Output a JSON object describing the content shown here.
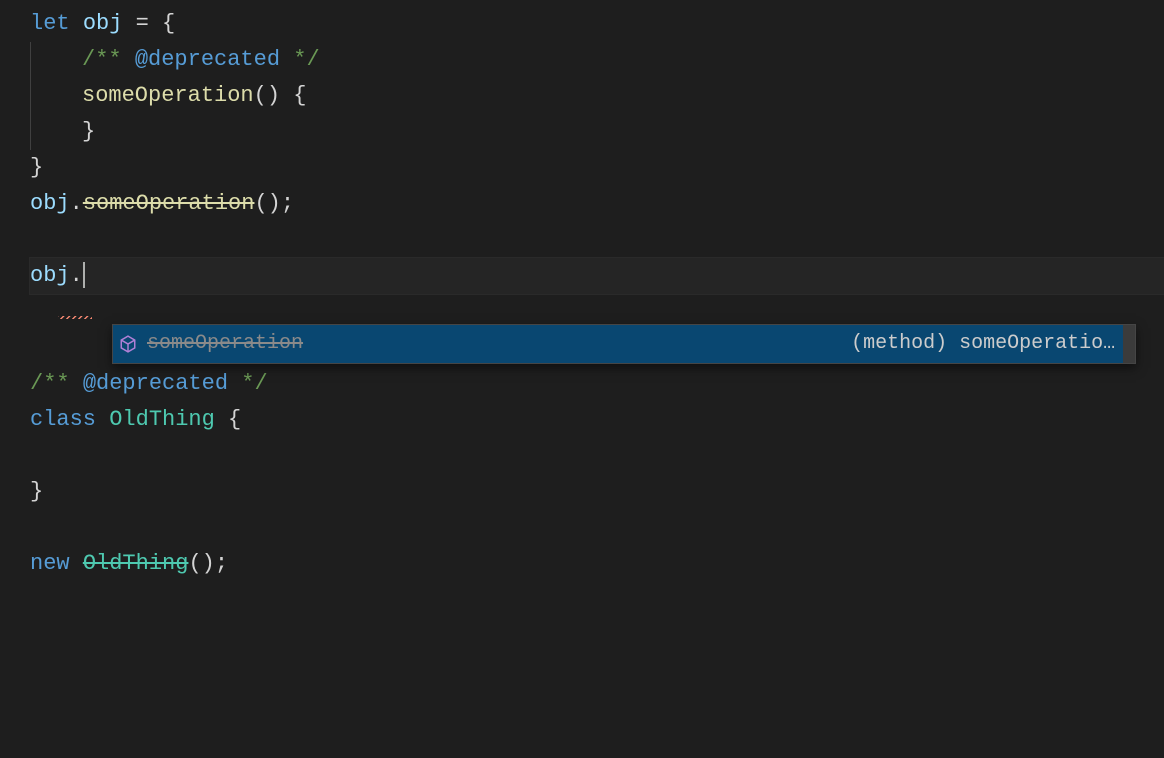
{
  "code": {
    "line1": {
      "let": "let",
      "sp1": " ",
      "obj": "obj",
      "sp2": " ",
      "eq": "=",
      "sp3": " ",
      "brace": "{"
    },
    "line2": {
      "comment_open": "/** ",
      "tag": "@deprecated",
      "comment_close": " */"
    },
    "line3": {
      "fn": "someOperation",
      "call": "() {"
    },
    "line4": {
      "brace": "}"
    },
    "line5": {
      "brace": "}"
    },
    "line6": {
      "obj": "obj",
      "dot": ".",
      "fn": "someOperation",
      "call": "();"
    },
    "line8": {
      "obj": "obj",
      "dot": "."
    },
    "line11": {
      "open": "/** ",
      "tag": "@deprecated",
      "close": " */"
    },
    "line12": {
      "class": "class",
      "sp": " ",
      "name": "OldThing",
      "rest": " {"
    },
    "line14": {
      "brace": "}"
    },
    "line16": {
      "new": "new",
      "sp": " ",
      "name": "OldThing",
      "call": "();"
    }
  },
  "suggest": {
    "label": "someOperation",
    "detail": "(method) someOperatio…"
  },
  "colors": {
    "bg": "#1e1e1e",
    "selection": "#094771"
  }
}
